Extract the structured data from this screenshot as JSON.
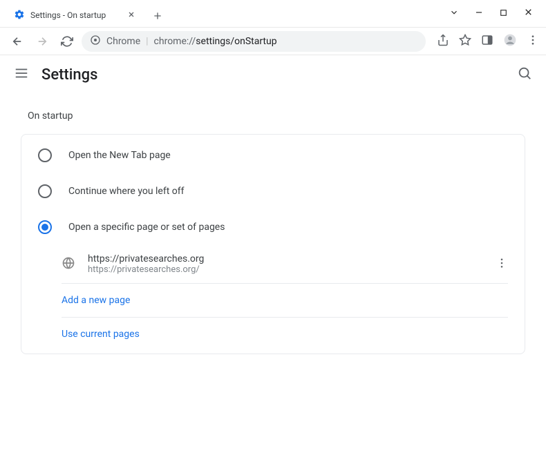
{
  "window": {
    "tab_title": "Settings - On startup"
  },
  "omnibox": {
    "prefix": "Chrome",
    "url_grey": "chrome://",
    "url_dark": "settings/onStartup"
  },
  "header": {
    "title": "Settings"
  },
  "section": {
    "title": "On startup",
    "options": {
      "o1": "Open the New Tab page",
      "o2": "Continue where you left off",
      "o3": "Open a specific page or set of pages"
    },
    "page": {
      "title": "https://privatesearches.org",
      "url": "https://privatesearches.org/"
    },
    "links": {
      "add": "Add a new page",
      "use_current": "Use current pages"
    }
  }
}
